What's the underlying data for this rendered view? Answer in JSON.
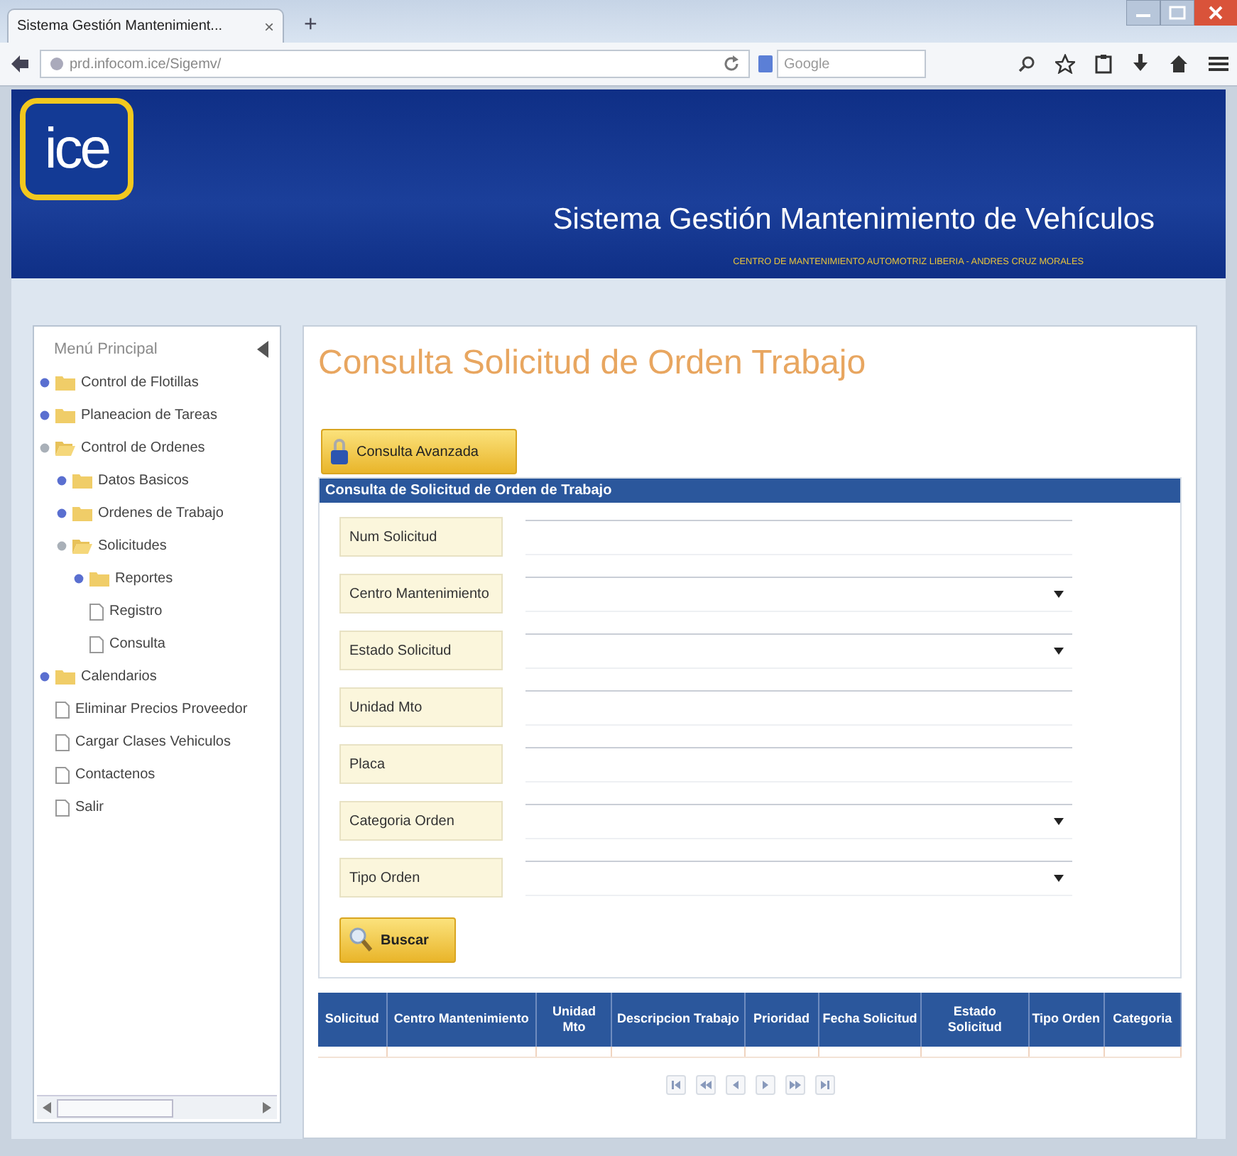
{
  "browser": {
    "tab_title": "Sistema Gestión Mantenimient...",
    "tab_close": "×",
    "new_tab": "+",
    "url": "prd.infocom.ice/Sigemv/",
    "search_placeholder": "Google"
  },
  "header": {
    "logo": "ice",
    "title": "Sistema Gestión Mantenimiento de Vehículos",
    "subtitle": "CENTRO DE MANTENIMIENTO AUTOMOTRIZ LIBERIA - ANDRES CRUZ MORALES"
  },
  "sidebar": {
    "title": "Menú Principal",
    "items": [
      {
        "label": "Control de Flotillas",
        "kind": "folder",
        "expanded": false
      },
      {
        "label": "Planeacion de Tareas",
        "kind": "folder",
        "expanded": false
      },
      {
        "label": "Control de Ordenes",
        "kind": "folder",
        "expanded": true,
        "children": [
          {
            "label": "Datos Basicos",
            "kind": "folder",
            "expanded": false
          },
          {
            "label": "Ordenes de Trabajo",
            "kind": "folder",
            "expanded": false
          },
          {
            "label": "Solicitudes",
            "kind": "folder",
            "expanded": true,
            "children": [
              {
                "label": "Reportes",
                "kind": "folder",
                "expanded": false
              },
              {
                "label": "Registro",
                "kind": "page"
              },
              {
                "label": "Consulta",
                "kind": "page"
              }
            ]
          }
        ]
      },
      {
        "label": "Calendarios",
        "kind": "folder",
        "expanded": false
      },
      {
        "label": "Eliminar Precios Proveedor",
        "kind": "page"
      },
      {
        "label": "Cargar Clases Vehiculos",
        "kind": "page"
      },
      {
        "label": "Contactenos",
        "kind": "page"
      },
      {
        "label": "Salir",
        "kind": "page"
      }
    ]
  },
  "main": {
    "heading": "Consulta Solicitud de Orden Trabajo",
    "advanced_button": "Consulta Avanzada",
    "form_title": "Consulta de Solicitud de Orden de Trabajo",
    "fields": [
      {
        "label": "Num Solicitud",
        "kind": "text"
      },
      {
        "label": "Centro Mantenimiento",
        "kind": "select"
      },
      {
        "label": "Estado Solicitud",
        "kind": "select"
      },
      {
        "label": "Unidad Mto",
        "kind": "text"
      },
      {
        "label": "Placa",
        "kind": "text"
      },
      {
        "label": "Categoria Orden",
        "kind": "select"
      },
      {
        "label": "Tipo Orden",
        "kind": "select"
      }
    ],
    "search_button": "Buscar",
    "table": {
      "columns": [
        "Solicitud",
        "Centro Mantenimiento",
        "Unidad Mto",
        "Descripcion Trabajo",
        "Prioridad",
        "Fecha Solicitud",
        "Estado Solicitud",
        "Tipo Orden",
        "Categoria"
      ]
    }
  }
}
